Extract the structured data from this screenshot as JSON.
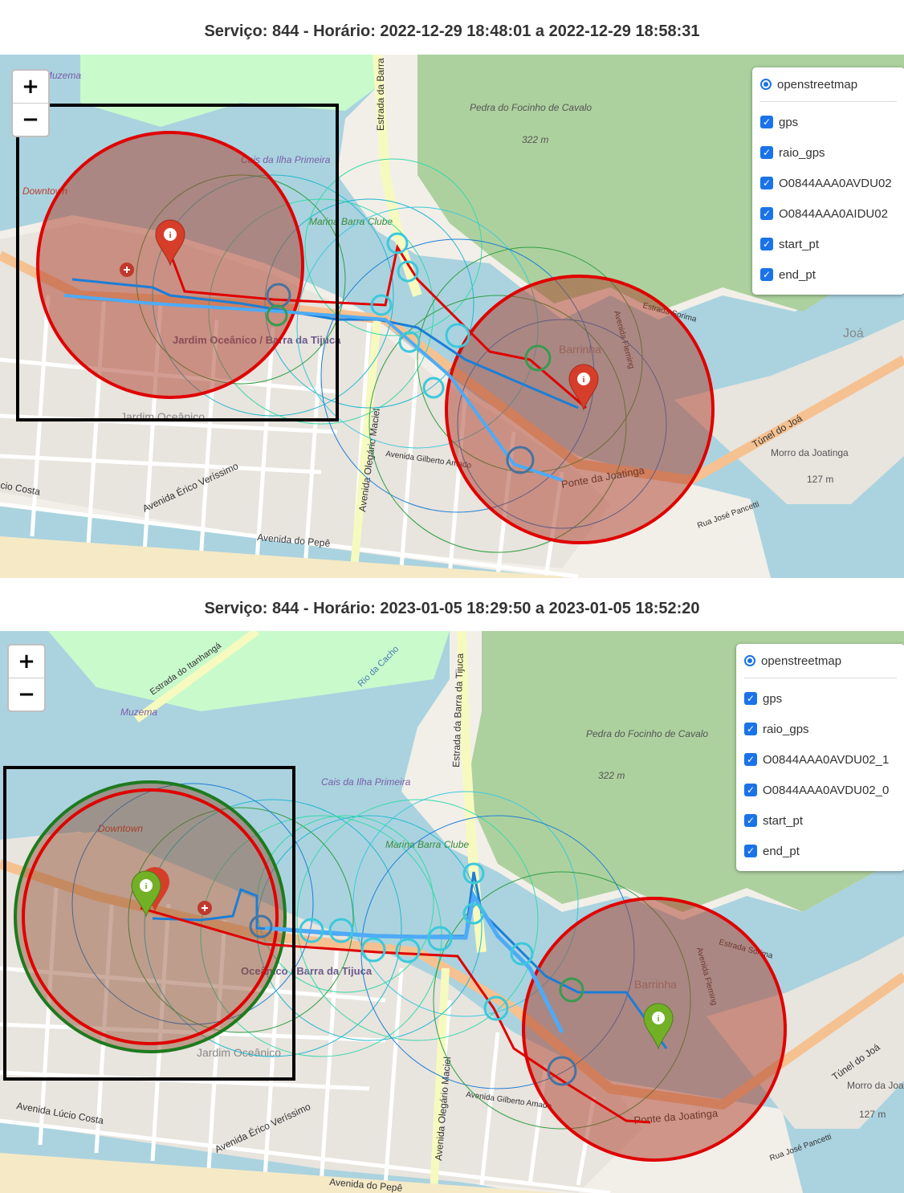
{
  "maps": [
    {
      "title": "Serviço: 844 - Horário: 2022-12-29 18:48:01 a 2022-12-29 18:58:31",
      "zoom": {
        "plus": "+",
        "minus": "−"
      },
      "layers": {
        "base": "openstreetmap",
        "overlays": [
          "gps",
          "raio_gps",
          "O0844AAA0AVDU02",
          "O0844AAA0AIDU02",
          "start_pt",
          "end_pt"
        ]
      },
      "markers": [
        {
          "type": "start",
          "color": "#d63e2a",
          "icon": "info-icon"
        },
        {
          "type": "end",
          "color": "#d63e2a",
          "icon": "info-icon"
        }
      ],
      "places": {
        "muzema": "Muzema",
        "downtown": "Downtown",
        "cais": "Cais da Ilha Primeira",
        "marina": "Marina Barra Clube",
        "pedra": "Pedra do Focinho de Cavalo",
        "pedra_alt": "322 m",
        "jardim": "Jardim Oceânico / Barra da Tijuca",
        "jardim_oceanico": "Jardim Oceânico",
        "barrinha": "Barrinha",
        "joa": "Joá",
        "morro": "Morro da Joatinga",
        "morro_alt": "127 m",
        "estrada_barra": "Estrada da Barra",
        "ponte": "Ponte da Joatinga",
        "tunel": "Túnel do Joá",
        "av_erico": "Avenida Érico Veríssimo",
        "av_olegario": "Avenida Olegário Maciel",
        "av_pepe": "Avenida do Pepê",
        "av_gilberto": "Avenida Gilberto Amado",
        "rua_jose": "Rua José Pancetti",
        "estrada_sorima": "Estrada Sorima",
        "av_fleming": "Avenida Fleming",
        "cio_costa": "cio Costa"
      }
    },
    {
      "title": "Serviço: 844 - Horário: 2023-01-05 18:29:50 a 2023-01-05 18:52:20",
      "zoom": {
        "plus": "+",
        "minus": "−"
      },
      "layers": {
        "base": "openstreetmap",
        "overlays": [
          "gps",
          "raio_gps",
          "O0844AAA0AVDU02_1",
          "O0844AAA0AVDU02_0",
          "start_pt",
          "end_pt"
        ]
      },
      "markers": [
        {
          "type": "start",
          "color": "#72b026",
          "icon": "info-icon"
        },
        {
          "type": "end",
          "color": "#72b026",
          "icon": "info-icon"
        }
      ],
      "places": {
        "muzema": "Muzema",
        "downtown": "Downtown",
        "cais": "Cais da Ilha Primeira",
        "marina": "Marina Barra Clube",
        "pedra": "Pedra do Focinho de Cavalo",
        "pedra_alt": "322 m",
        "jardim": "Oceânico / Barra da Tijuca",
        "jardim_oceanico": "Jardim Oceânico",
        "barrinha": "Barrinha",
        "morro": "Morro da Joatinga",
        "morro_alt": "127 m",
        "estrada_barra": "Estrada da Barra da Tijuca",
        "estrada_itanhanga": "Estrada do Itanhangá",
        "ponte": "Ponte da Joatinga",
        "tunel": "Túnel do Joá",
        "av_erico": "Avenida Érico Veríssimo",
        "av_lucio": "Avenida Lúcio Costa",
        "av_olegario": "Avenida Olegário Maciel",
        "av_pepe": "Avenida do Pepê",
        "av_gilberto": "Avenida Gilberto Amado",
        "rio_cacho": "Rio da Cacho",
        "rua_jose": "Rua José Pancetti",
        "estrada_sorima": "Estrada Sorima",
        "av_fleming": "Avenida Fleming"
      }
    }
  ]
}
